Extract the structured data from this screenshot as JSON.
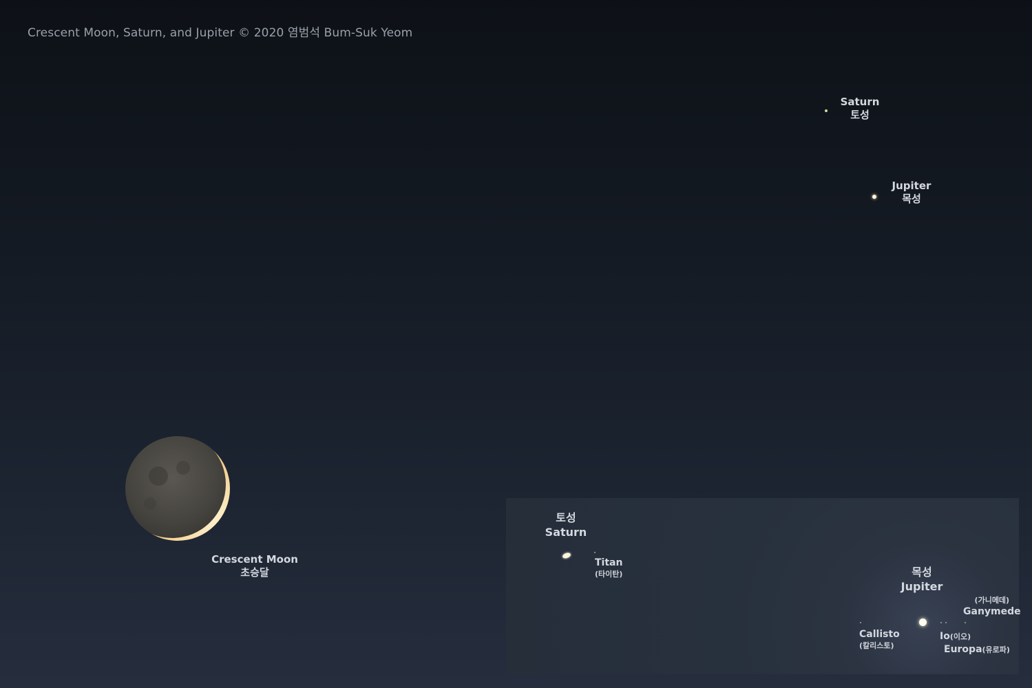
{
  "credit": "Crescent Moon, Saturn, and Jupiter © 2020 염범석 Bum-Suk Yeom",
  "main": {
    "saturn": {
      "en": "Saturn",
      "ko": "토성"
    },
    "jupiter": {
      "en": "Jupiter",
      "ko": "목성"
    },
    "moon": {
      "en": "Crescent Moon",
      "ko": "초승달"
    }
  },
  "inset": {
    "saturn": {
      "ko": "토성",
      "en": "Saturn"
    },
    "titan": {
      "en": "Titan",
      "ko": "(타이탄)"
    },
    "jupiter": {
      "ko": "목성",
      "en": "Jupiter"
    },
    "ganymede": {
      "ko": "(가니메데)",
      "en": "Ganymede"
    },
    "callisto": {
      "en": "Callisto",
      "ko": "(칼리스토)"
    },
    "io": {
      "en": "Io",
      "ko": "(이오)"
    },
    "europa": {
      "en": "Europa",
      "ko": "(유로파)"
    }
  },
  "colors": {
    "moon_lit": "#f4d9a0",
    "earthshine": "#4a4845",
    "label": "#d4d8df"
  }
}
